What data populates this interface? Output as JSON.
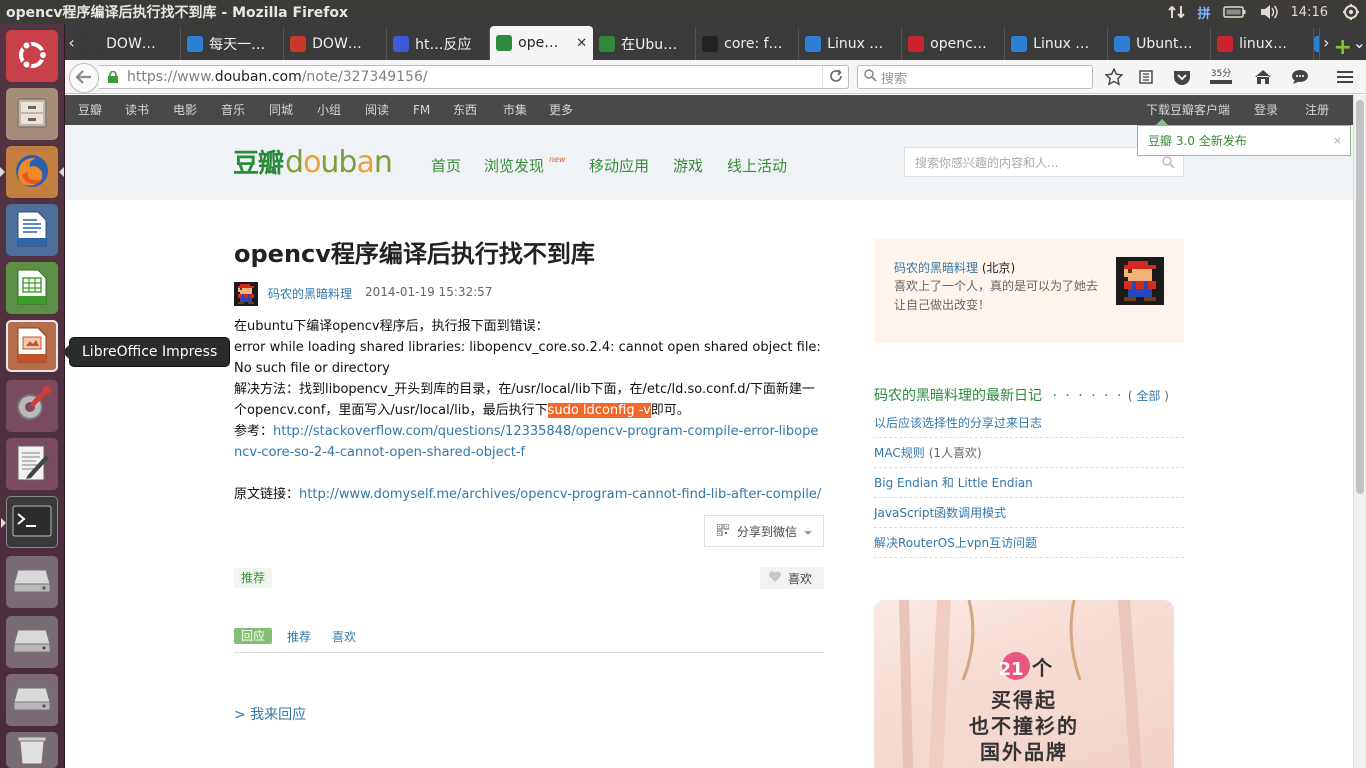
{
  "window": {
    "title": "opencv程序编译后执行找不到库 - Mozilla Firefox"
  },
  "panel": {
    "ime": "拼",
    "clock": "14:16"
  },
  "launcher": {
    "tooltip": "LibreOffice Impress"
  },
  "tabs": [
    {
      "label": "DOW…",
      "fav_color": "#3b3b3b"
    },
    {
      "label": "每天一…",
      "fav_color": "#2d7fd3"
    },
    {
      "label": "DOW…",
      "fav_color": "#c8382b"
    },
    {
      "label": "ht…反应",
      "fav_color": "#3d5bd9"
    },
    {
      "label": "ope…",
      "fav_color": "#2f8b3b",
      "selected": true
    },
    {
      "label": "在Ubu…",
      "fav_color": "#2f8b3b"
    },
    {
      "label": "core: f…",
      "fav_color": "#222222"
    },
    {
      "label": "Linux …",
      "fav_color": "#2d7fd3"
    },
    {
      "label": "openc…",
      "fav_color": "#c9232b"
    },
    {
      "label": "Linux …",
      "fav_color": "#2d7fd3"
    },
    {
      "label": "Ubunt…",
      "fav_color": "#2d7fd3"
    },
    {
      "label": "linux…",
      "fav_color": "#c9232b"
    }
  ],
  "navbar": {
    "url_prefix": "https://www.",
    "url_domain": "douban.com",
    "url_path": "/note/327349156/",
    "search_placeholder": "搜索",
    "badge": "35分"
  },
  "site_nav": {
    "left": [
      "豆瓣",
      "读书",
      "电影",
      "音乐",
      "同城",
      "小组",
      "阅读",
      "FM",
      "东西",
      "市集",
      "更多"
    ],
    "right": [
      "下载豆瓣客户端",
      "登录",
      "注册"
    ]
  },
  "header": {
    "logo_cn": "豆瓣",
    "logo_en": "douban",
    "nav": [
      "首页",
      "浏览发现",
      "移动应用",
      "游戏",
      "线上活动"
    ],
    "new_badge": "new",
    "search_placeholder": "搜索你感兴趣的内容和人...",
    "notice": "豆瓣 3.0 全新发布",
    "notice_close": "×"
  },
  "article": {
    "title": "opencv程序编译后执行找不到库",
    "author": "码农的黑暗料理",
    "date": "2014-01-19 15:32:57",
    "p1": "在ubuntu下编译opencv程序后，执行报下面到错误：",
    "p2": "error while loading shared libraries: libopencv_core.so.2.4: cannot open shared object file: No such file or directory",
    "p3_a": "解决方法：找到libopencv_开头到库的目录，在/usr/local/lib下面，在/etc/ld.so.conf.d/下面新建一个opencv.conf，里面写入/usr/local/lib，最后执行下",
    "p3_hl": "sudo ldconfig -v",
    "p3_b": "即可。",
    "ref_label": "参考：",
    "ref_link": "http://stackoverflow.com/questions/12335848/opencv-program-compile-error-libopencv-core-so-2-4-cannot-open-shared-object-f",
    "orig_label": "原文链接：",
    "orig_link": "http://www.domyself.me/archives/opencv-program-cannot-find-lib-after-compile/",
    "share": "分享到微信",
    "recommend_tag": "推荐",
    "like": "喜欢",
    "reply_tabs": [
      "回应",
      "推荐",
      "喜欢"
    ],
    "add_reply": "> 我来回应"
  },
  "sidebar": {
    "profile_name": "码农的黑暗料理",
    "profile_loc": " (北京)",
    "profile_bio": "喜欢上了一个人，真的是可以为了她去让自己做出改变！",
    "latest_title": "码农的黑暗料理的最新日记",
    "latest_dots": "· · · · · ·",
    "latest_all_open": "( ",
    "latest_all": "全部",
    "latest_all_close": " )",
    "latest": [
      {
        "title": "以后应该选择性的分享过来日志",
        "count": ""
      },
      {
        "title": "MAC规则",
        "count": "(1人喜欢)"
      },
      {
        "title": "Big Endian 和 Little Endian",
        "count": ""
      },
      {
        "title": "JavaScript函数调用模式",
        "count": ""
      },
      {
        "title": "解决RouterOS上vpn互访问题",
        "count": ""
      }
    ],
    "ad_line1_num": "21",
    "ad_line1_txt": "个",
    "ad_line2": "买得起",
    "ad_line3": "也不撞衫的",
    "ad_line4": "国外品牌"
  }
}
